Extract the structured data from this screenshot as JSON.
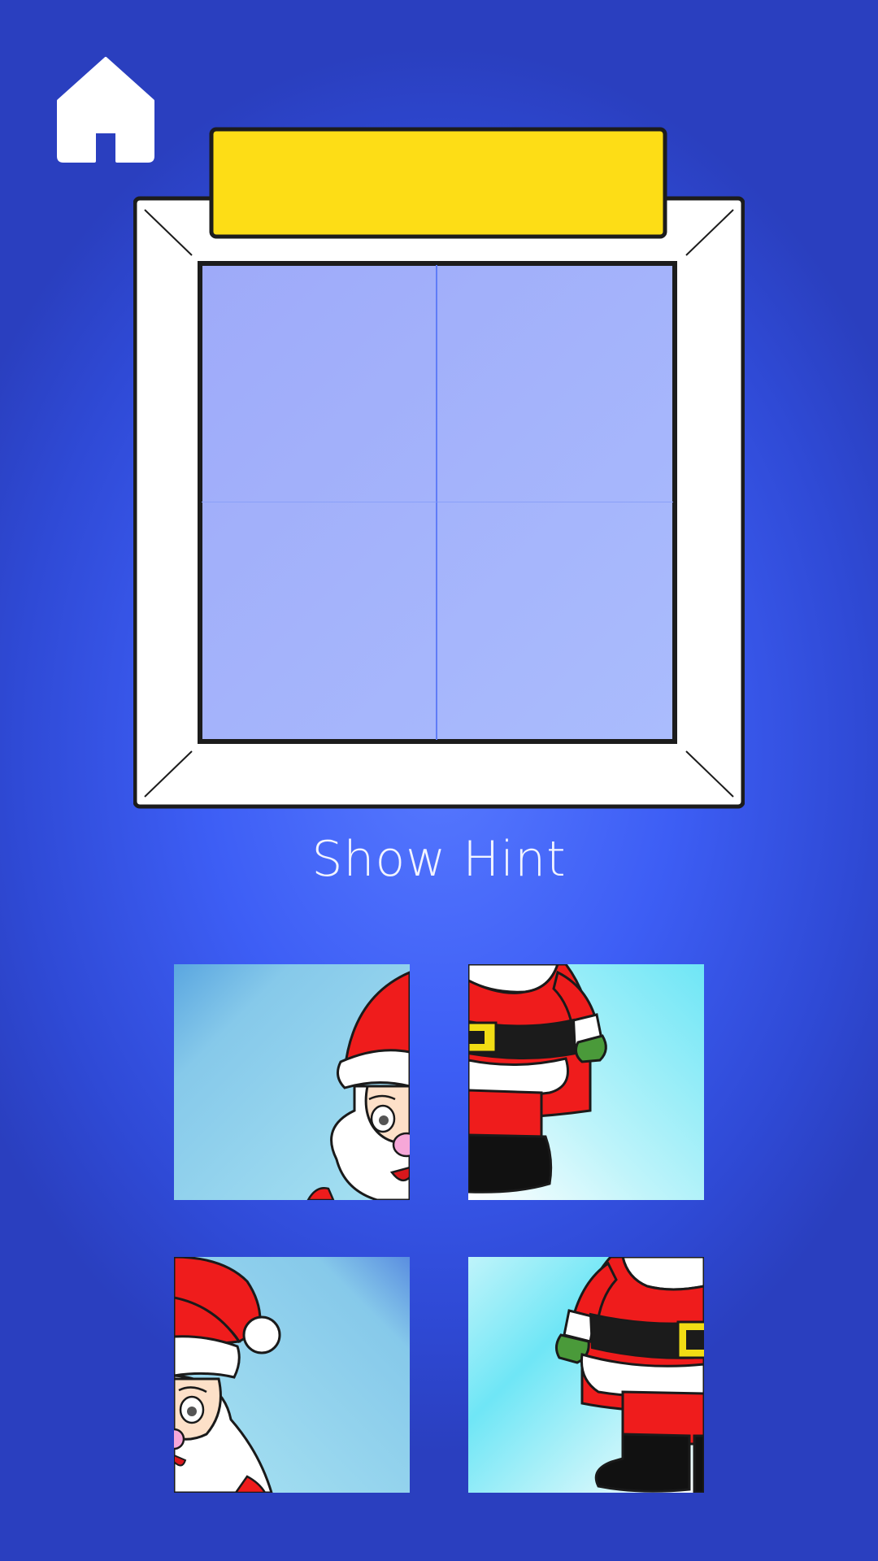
{
  "header": {
    "home_icon": "home-icon"
  },
  "puzzle": {
    "rows": 2,
    "columns": 2,
    "hint_label": "Show Hint",
    "colors": {
      "board_fill": "#a8b6fb",
      "title_bar": "#fddd16",
      "frame": "#ffffff",
      "outline": "#1c1c1c"
    }
  },
  "pieces": [
    {
      "name": "santa-hat-face-right-piece",
      "depicts": "santa-head"
    },
    {
      "name": "santa-belt-left-piece",
      "depicts": "santa-body"
    },
    {
      "name": "santa-hat-pompom-piece",
      "depicts": "santa-hat"
    },
    {
      "name": "santa-belt-right-piece",
      "depicts": "santa-body"
    }
  ]
}
